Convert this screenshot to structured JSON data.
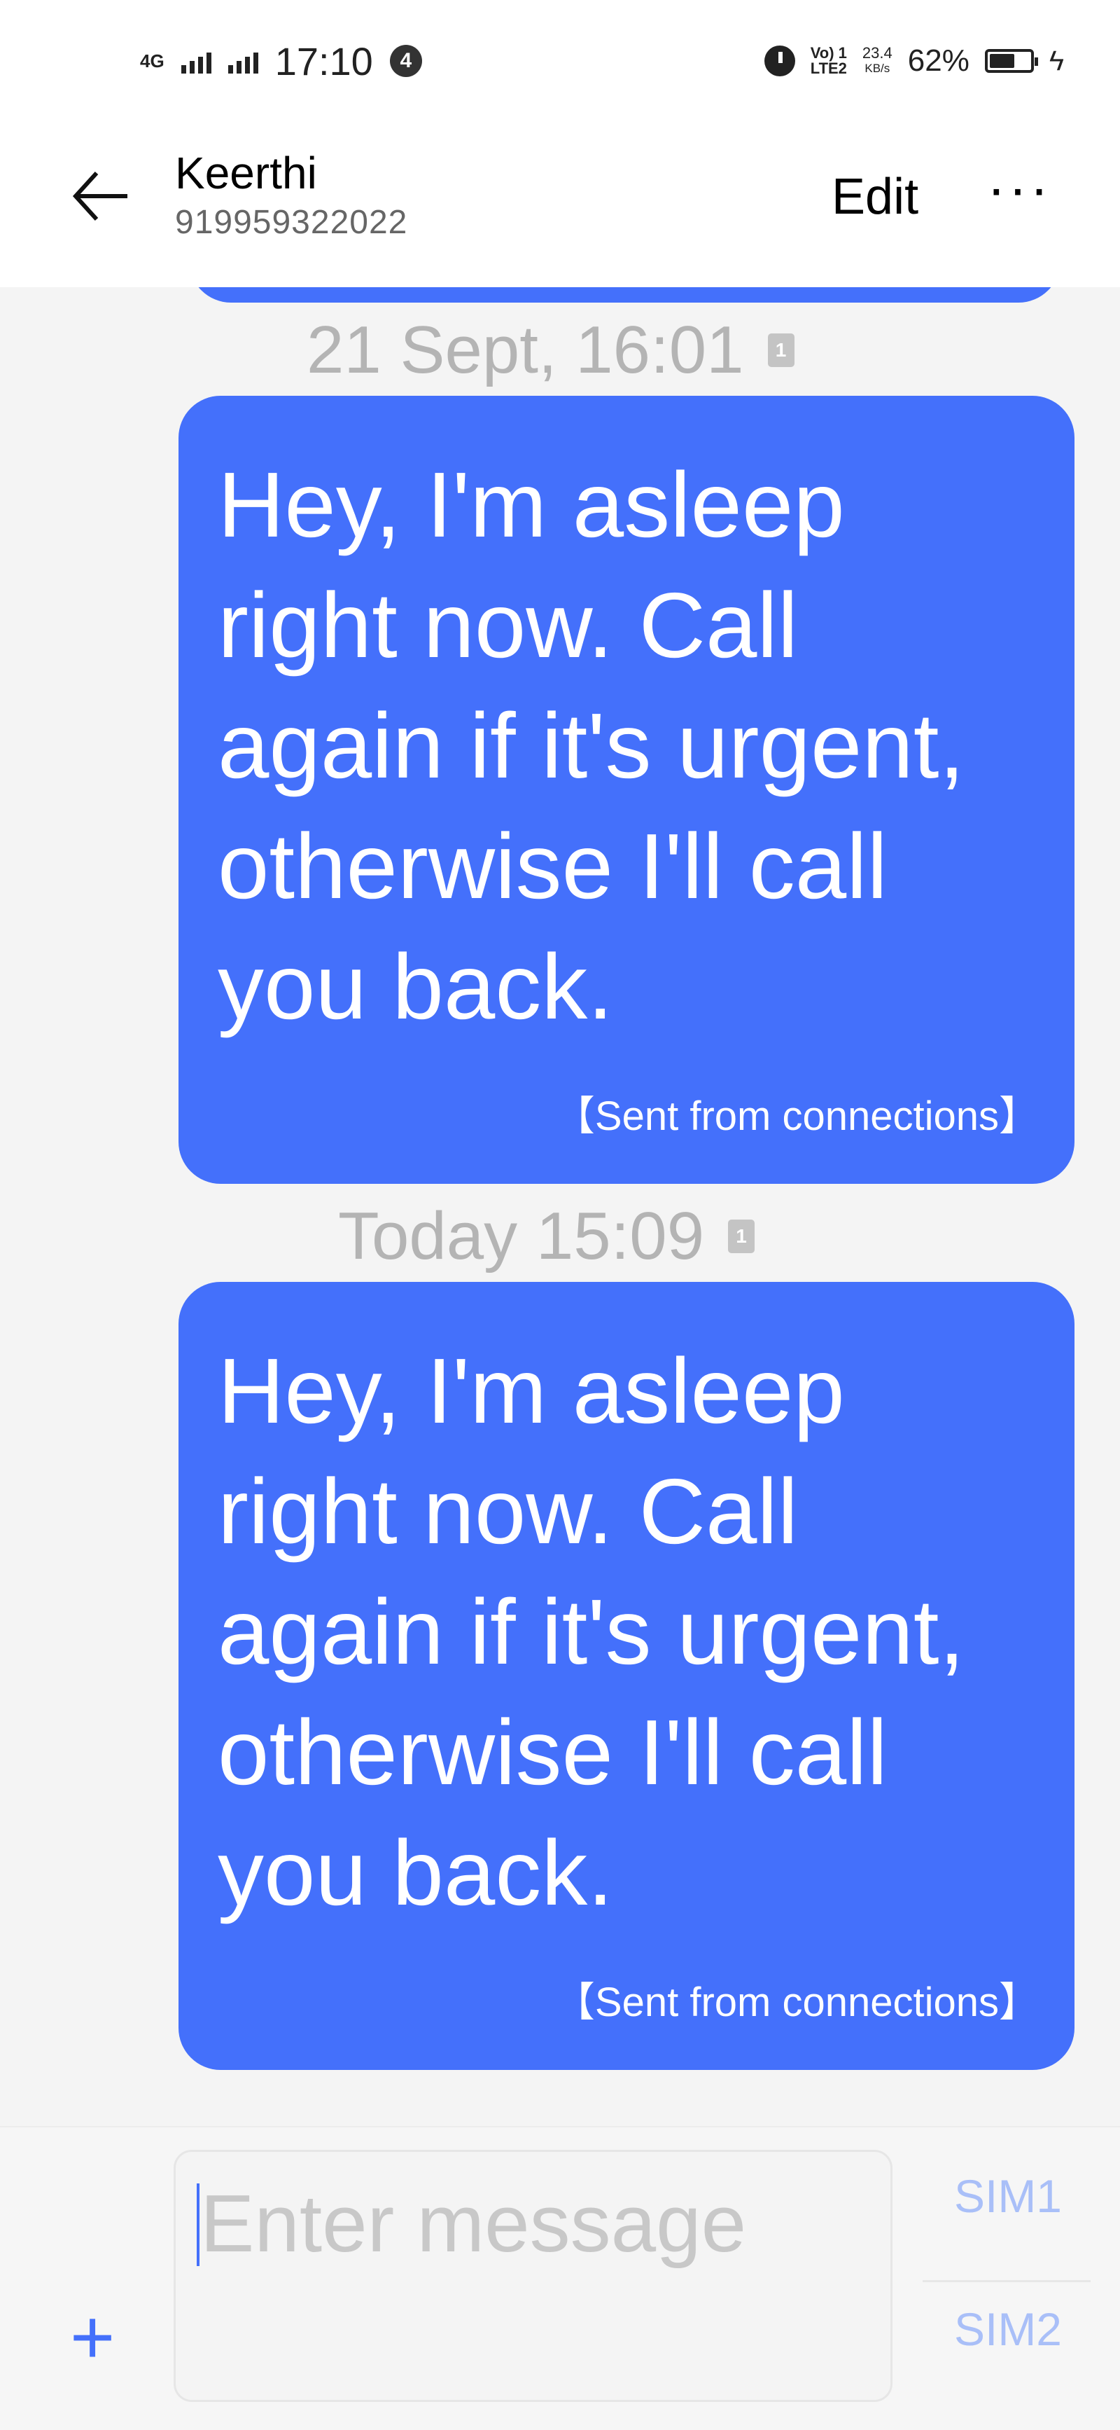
{
  "status_bar": {
    "network": "4G",
    "time": "17:10",
    "notification_count": "4",
    "volte_top": "Vo) 1",
    "volte_bottom": "LTE2",
    "speed_value": "23.4",
    "speed_unit": "KB/s",
    "battery_percent": "62%",
    "battery_level": 0.62
  },
  "header": {
    "contact_name": "Keerthi",
    "contact_number": "919959322022",
    "edit_label": "Edit",
    "more_label": "···"
  },
  "messages": [
    {
      "timestamp": "21 Sept, 16:01",
      "sim_badge": "1",
      "text": "Hey, I'm asleep right now. Call again if it's urgent, otherwise I'll call you back.",
      "signature": "【Sent from connections】"
    },
    {
      "timestamp": "Today 15:09",
      "sim_badge": "1",
      "text": "Hey, I'm asleep right now. Call again if it's urgent, otherwise I'll call you back.",
      "signature": "【Sent from connections】"
    }
  ],
  "composer": {
    "placeholder": "Enter message",
    "plus_label": "+",
    "sim1_label": "SIM1",
    "sim2_label": "SIM2"
  },
  "colors": {
    "bubble": "#4470fb",
    "accent": "#4470fb",
    "sim_button": "#a9bff8",
    "timestamp": "#b4b4b4"
  },
  "icons": [
    "signal-bars-icon",
    "alarm-icon",
    "battery-icon",
    "charging-bolt-icon",
    "back-arrow-icon",
    "more-icon",
    "sim-card-icon",
    "plus-icon"
  ]
}
